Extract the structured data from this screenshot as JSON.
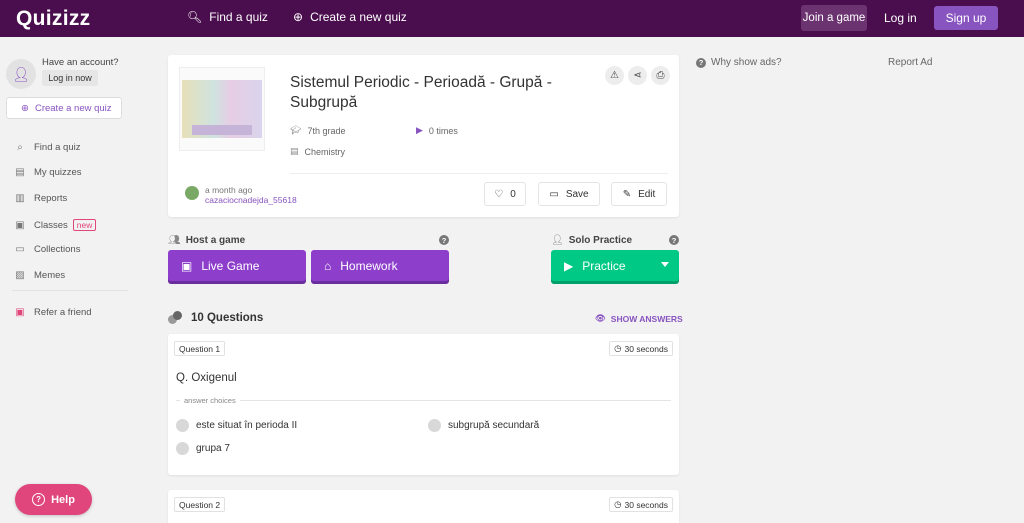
{
  "header": {
    "logo": "Quizizz",
    "find_quiz": "Find a quiz",
    "create_quiz": "Create a new quiz",
    "join_game": "Join a game",
    "login": "Log in",
    "signup": "Sign up"
  },
  "sidebar": {
    "have_account": "Have an account?",
    "login_now": "Log in now",
    "create_quiz": "Create a new quiz",
    "items": [
      {
        "label": "Find a quiz",
        "icon": "search-icon"
      },
      {
        "label": "My quizzes",
        "icon": "document-icon"
      },
      {
        "label": "Reports",
        "icon": "chart-icon"
      },
      {
        "label": "Classes",
        "icon": "classes-icon",
        "badge": "new"
      },
      {
        "label": "Collections",
        "icon": "folder-icon"
      },
      {
        "label": "Memes",
        "icon": "image-icon"
      }
    ],
    "refer": "Refer a friend"
  },
  "quiz": {
    "title": "Sistemul Periodic - Perioadă - Grupă - Subgrupă",
    "grade": "7th grade",
    "times": "0 times",
    "subject": "Chemistry",
    "author_time": "a month ago",
    "author_name": "cazaciocnadejda_55618",
    "likes": "0",
    "save": "Save",
    "edit": "Edit"
  },
  "actions": {
    "host_label": "Host a game",
    "solo_label": "Solo Practice",
    "live_game": "Live Game",
    "homework": "Homework",
    "practice": "Practice"
  },
  "questions": {
    "count": "10 Questions",
    "show_answers": "SHOW ANSWERS",
    "answer_choices_label": "answer choices",
    "items": [
      {
        "label": "Question 1",
        "time": "30 seconds",
        "text": "Q. Oxigenul",
        "choices": [
          "este situat în perioda II",
          "subgrupă secundară",
          "grupa 7"
        ]
      },
      {
        "label": "Question 2",
        "time": "30 seconds"
      }
    ]
  },
  "ads": {
    "why": "Why show ads?",
    "report": "Report Ad"
  },
  "help": "Help",
  "colors": {
    "topbar": "#4a0e4e",
    "accent": "#8854c0",
    "live_btn": "#8d3fcc",
    "practice_btn": "#00c985",
    "help_btn": "#e0457b"
  }
}
